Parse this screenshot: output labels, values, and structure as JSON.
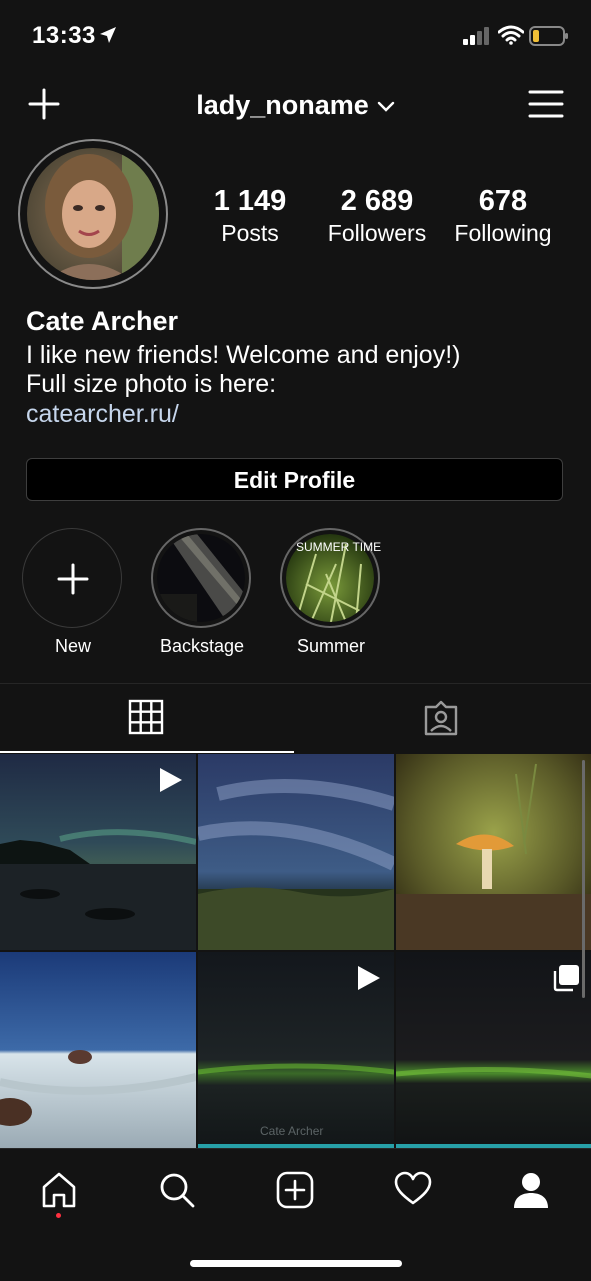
{
  "status": {
    "time": "13:33"
  },
  "header": {
    "username": "lady_noname"
  },
  "profile": {
    "stats": [
      {
        "value": "1 149",
        "label": "Posts"
      },
      {
        "value": "2 689",
        "label": "Followers"
      },
      {
        "value": "678",
        "label": "Following"
      }
    ],
    "name": "Cate Archer",
    "bio_line1": "I like new friends! Welcome and enjoy!)",
    "bio_line2": "Full size photo is here:",
    "link": "catearcher.ru/",
    "edit_button": "Edit Profile"
  },
  "highlights": [
    {
      "label": "New"
    },
    {
      "label": "Backstage"
    },
    {
      "label": "Summer",
      "cover_text": "SUMMER TIME"
    }
  ],
  "posts": {
    "watermark": "Cate Archer"
  },
  "tabs": [
    {
      "name": "grid",
      "active": true
    },
    {
      "name": "tagged",
      "active": false
    }
  ],
  "colors": {
    "background": "#131313",
    "link": "#c6d6ec",
    "notification_dot": "#ff3040"
  }
}
